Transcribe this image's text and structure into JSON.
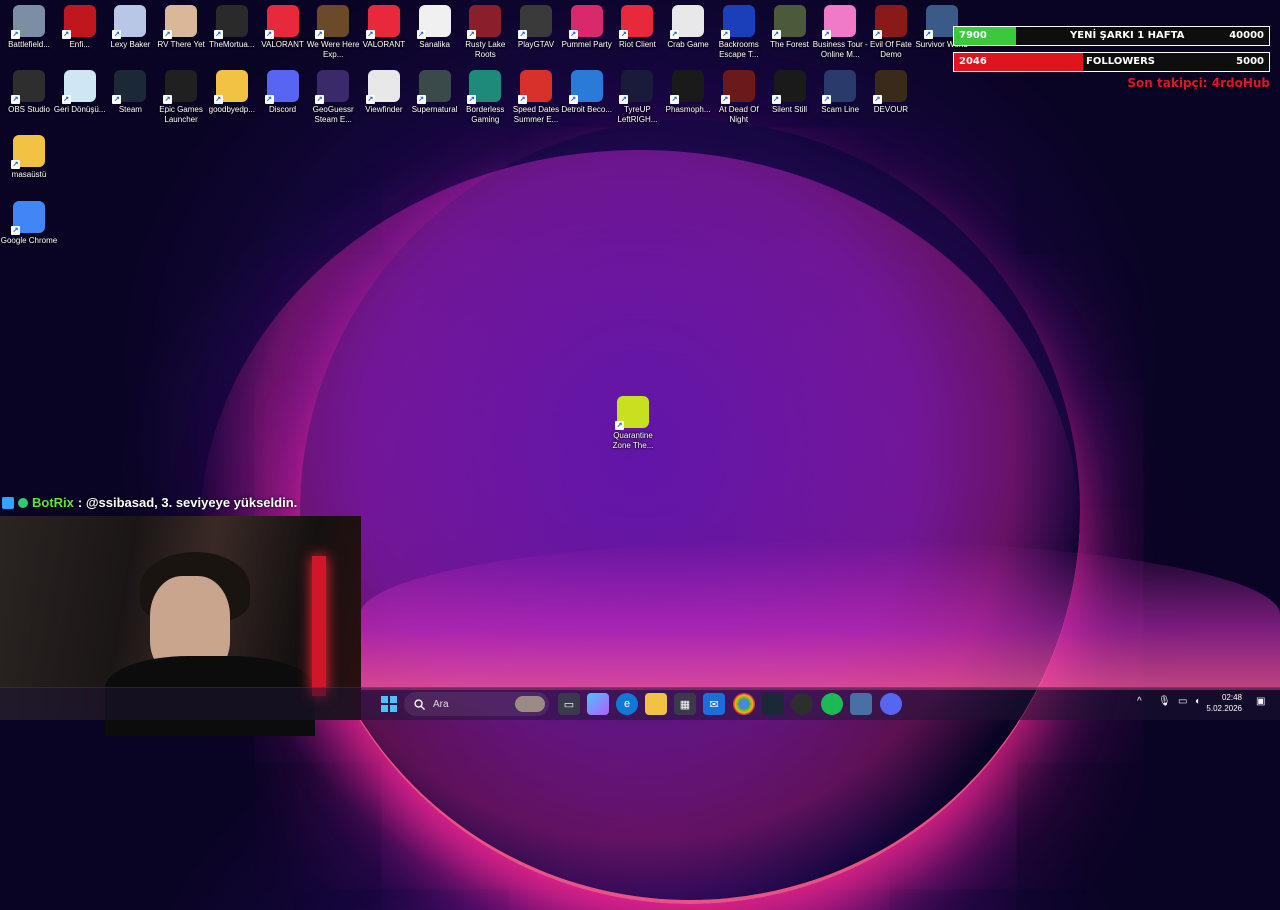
{
  "desktop": {
    "row1": [
      {
        "label": "Battlefield...",
        "color": "#7b8ea4"
      },
      {
        "label": "Enfi...",
        "color": "#c0161d"
      },
      {
        "label": "Lexy Baker",
        "color": "#b8c7e6"
      },
      {
        "label": "RV There Yet",
        "color": "#d9b89a"
      },
      {
        "label": "TheMortua...",
        "color": "#2a2a2a"
      },
      {
        "label": "VALORANT",
        "color": "#e8293c"
      },
      {
        "label": "We Were Here Exp...",
        "color": "#6b4a2a"
      },
      {
        "label": "VALORANT",
        "color": "#e8293c"
      },
      {
        "label": "Sanalika",
        "color": "#f0f0f0"
      },
      {
        "label": "Rusty Lake Roots",
        "color": "#8a1e2a"
      },
      {
        "label": "PlayGTAV",
        "color": "#3a3a3a"
      },
      {
        "label": "Pummel Party",
        "color": "#d82a6a"
      },
      {
        "label": "Riot Client",
        "color": "#e8293c"
      },
      {
        "label": "Crab Game",
        "color": "#e8e8e8"
      },
      {
        "label": "Backrooms Escape T...",
        "color": "#1a3fb8"
      },
      {
        "label": "The Forest",
        "color": "#4a5a3a"
      },
      {
        "label": "Business Tour - Online M...",
        "color": "#f07ac8"
      },
      {
        "label": "Evil Of Fate Demo",
        "color": "#8a1a1a"
      },
      {
        "label": "Survivor World",
        "color": "#3a5a8a"
      }
    ],
    "row2": [
      {
        "label": "OBS Studio",
        "color": "#2e2e2e"
      },
      {
        "label": "Geri Dönüşü...",
        "color": "#cfe6f5"
      },
      {
        "label": "Steam",
        "color": "#1b2838"
      },
      {
        "label": "Epic Games Launcher",
        "color": "#202020"
      },
      {
        "label": "goodbyedp...",
        "color": "#f2c244"
      },
      {
        "label": "Discord",
        "color": "#5865f2"
      },
      {
        "label": "GeoGuessr Steam E...",
        "color": "#3a2a6a"
      },
      {
        "label": "Viewfinder",
        "color": "#e8e8e8"
      },
      {
        "label": "Supernatural",
        "color": "#3a4a4a"
      },
      {
        "label": "Borderless Gaming",
        "color": "#1e8a7a"
      },
      {
        "label": "Speed Dates Summer E...",
        "color": "#d8302a"
      },
      {
        "label": "Detroit Beco...",
        "color": "#2a7ad8"
      },
      {
        "label": "TyreUP LeftRIGH...",
        "color": "#1a1a3a"
      },
      {
        "label": "Phasmoph...",
        "color": "#1a1a1a"
      },
      {
        "label": "At Dead Of Night",
        "color": "#6a1a1a"
      },
      {
        "label": "Silent Still",
        "color": "#1a1a1a"
      },
      {
        "label": "Scam Line",
        "color": "#2a3a6a"
      },
      {
        "label": "DEVOUR",
        "color": "#3a2a1a"
      }
    ],
    "col1": [
      {
        "label": "masaüstü",
        "color": "#f2c244"
      },
      {
        "label": "Google Chrome",
        "color": "#4285f4"
      }
    ],
    "center": {
      "label": "Quarantine Zone The...",
      "color": "#c8e020"
    }
  },
  "goals": {
    "song": {
      "current": "7900",
      "title": "YENİ ŞARKI 1 HAFTA",
      "target": "40000",
      "progress": 0.198,
      "color": "#3cc83c"
    },
    "followers": {
      "current": "2046",
      "title": "FOLLOWERS",
      "target": "5000",
      "progress": 0.409,
      "color": "#e0141e"
    },
    "last_follower": "Son takipçi: 4rdoHub"
  },
  "chat": {
    "user": "BotRix",
    "message": ": @ssibasad, 3. seviyeye yükseldin."
  },
  "taskbar": {
    "search_placeholder": "Ara",
    "time": "02:48",
    "date": "5.02.2026"
  }
}
